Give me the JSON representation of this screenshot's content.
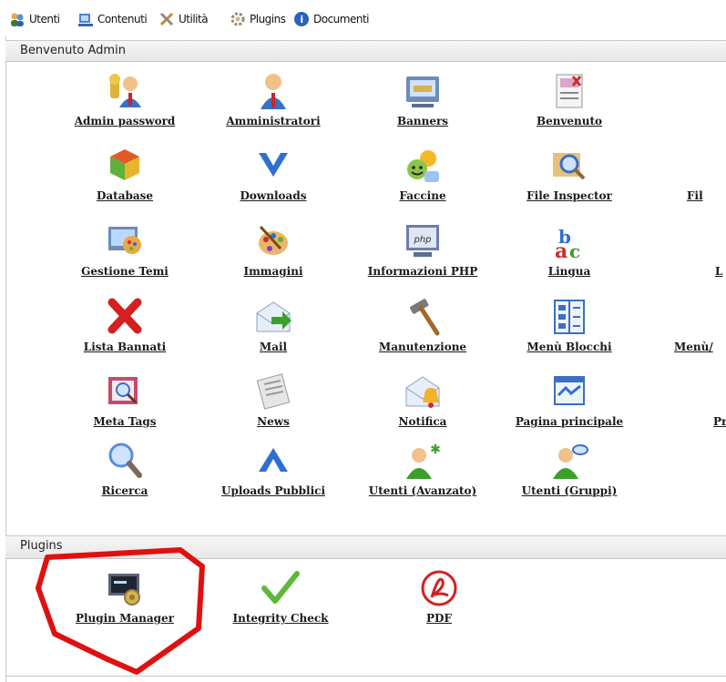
{
  "menubar": {
    "items": [
      {
        "label": "Utenti",
        "icon": "users-icon"
      },
      {
        "label": "Contenuti",
        "icon": "contents-icon"
      },
      {
        "label": "Utilità",
        "icon": "tools-icon"
      },
      {
        "label": "Plugins",
        "icon": "plugins-icon"
      },
      {
        "label": "Documenti",
        "icon": "documents-icon"
      }
    ]
  },
  "admin_section": {
    "title": "Benvenuto Admin",
    "tiles": [
      {
        "label": "Admin password",
        "icon": "key-user-icon"
      },
      {
        "label": "Amministratori",
        "icon": "admin-user-icon"
      },
      {
        "label": "Banners",
        "icon": "banner-icon"
      },
      {
        "label": "Benvenuto",
        "icon": "welcome-icon"
      },
      {
        "label": "Database",
        "icon": "database-icon"
      },
      {
        "label": "Downloads",
        "icon": "download-chevron-icon"
      },
      {
        "label": "Faccine",
        "icon": "smiley-icon"
      },
      {
        "label": "File Inspector",
        "icon": "file-inspector-icon"
      },
      {
        "label": "Fil",
        "icon": "partial-icon"
      },
      {
        "label": "Gestione Temi",
        "icon": "themes-icon"
      },
      {
        "label": "Immagini",
        "icon": "palette-icon"
      },
      {
        "label": "Informazioni PHP",
        "icon": "php-icon"
      },
      {
        "label": "Lingua",
        "icon": "abc-icon"
      },
      {
        "label": "L",
        "icon": "partial-icon"
      },
      {
        "label": "Lista Bannati",
        "icon": "red-x-icon"
      },
      {
        "label": "Mail",
        "icon": "mail-icon"
      },
      {
        "label": "Manutenzione",
        "icon": "hammer-icon"
      },
      {
        "label": "Menù Blocchi",
        "icon": "menu-blocks-icon"
      },
      {
        "label": "Menù/",
        "icon": "partial-icon"
      },
      {
        "label": "Meta Tags",
        "icon": "meta-tags-icon"
      },
      {
        "label": "News",
        "icon": "news-icon"
      },
      {
        "label": "Notifica",
        "icon": "notify-icon"
      },
      {
        "label": "Pagina principale",
        "icon": "main-page-icon"
      },
      {
        "label": "Pr",
        "icon": "partial-icon"
      },
      {
        "label": "Ricerca",
        "icon": "magnifier-icon"
      },
      {
        "label": "Uploads Pubblici",
        "icon": "upload-chevron-icon"
      },
      {
        "label": "Utenti (Avanzato)",
        "icon": "user-plus-icon"
      },
      {
        "label": "Utenti (Gruppi)",
        "icon": "user-group-icon"
      }
    ]
  },
  "plugins_section": {
    "title": "Plugins",
    "tiles": [
      {
        "label": "Plugin Manager",
        "icon": "plugin-manager-icon"
      },
      {
        "label": "Integrity Check",
        "icon": "checkmark-icon"
      },
      {
        "label": "PDF",
        "icon": "pdf-icon"
      }
    ]
  },
  "colors": {
    "annotation_red": "#e01010",
    "header_bg": "#ececec",
    "label_text": "#1a1a1a"
  }
}
